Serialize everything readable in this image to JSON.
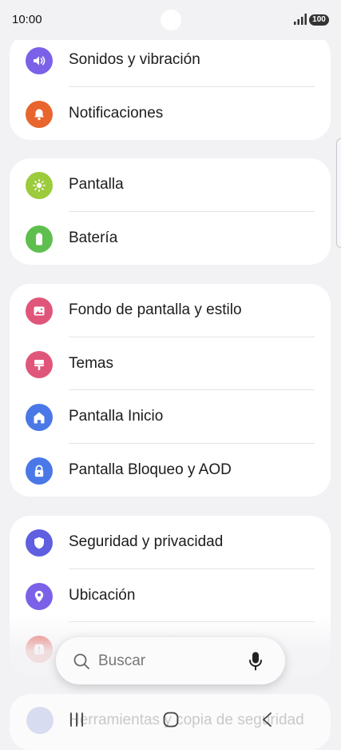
{
  "status_bar": {
    "time": "10:00",
    "battery": "100"
  },
  "groups": [
    {
      "items": [
        {
          "label": "Sonidos y vibración",
          "icon": "speaker-icon",
          "color": "#7b61e8"
        },
        {
          "label": "Notificaciones",
          "icon": "bell-icon",
          "color": "#e8662e"
        }
      ]
    },
    {
      "items": [
        {
          "label": "Pantalla",
          "icon": "sun-icon",
          "color": "#9ccb3b"
        },
        {
          "label": "Batería",
          "icon": "battery-icon",
          "color": "#5fbf4e"
        }
      ]
    },
    {
      "items": [
        {
          "label": "Fondo de pantalla y estilo",
          "icon": "image-icon",
          "color": "#e0567a"
        },
        {
          "label": "Temas",
          "icon": "brush-icon",
          "color": "#e0567a"
        },
        {
          "label": "Pantalla Inicio",
          "icon": "home-icon",
          "color": "#4a78e6"
        },
        {
          "label": "Pantalla Bloqueo y AOD",
          "icon": "lock-icon",
          "color": "#4a78e6"
        }
      ]
    },
    {
      "items": [
        {
          "label": "Seguridad y privacidad",
          "icon": "shield-icon",
          "color": "#5f5fe0"
        },
        {
          "label": "Ubicación",
          "icon": "location-pin-icon",
          "color": "#7b61e8"
        },
        {
          "label": "",
          "icon": "alert-icon",
          "color": "#e35a4e"
        }
      ]
    }
  ],
  "search": {
    "placeholder": "Buscar"
  },
  "partial_item": {
    "label": "Herramientas y copia de seguridad"
  }
}
